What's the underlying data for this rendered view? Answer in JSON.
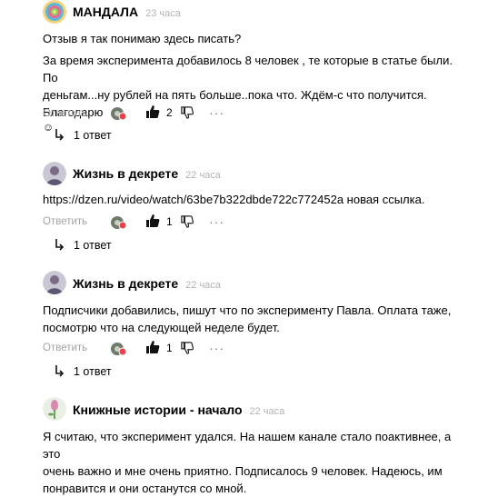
{
  "comments": [
    {
      "author": "МАНДАЛА",
      "time": "23 часа",
      "avatar": "mandala-avatar",
      "lines": [
        "Отзыв я так понимаю здесь писать?",
        "За время эксперимента добавилось 8 человек , те которые в статье были. По",
        "деньгам...ну рублей на пять больше..пока что. Ждём-с что получится. Благодарю"
      ],
      "reply_label": "Ответить",
      "likes": "2",
      "replies_label": "1 ответ"
    },
    {
      "author": "Жизнь в декрете",
      "time": "22 часа",
      "avatar": "person-avatar",
      "lines": [
        "https://dzen.ru/video/watch/63be7b322dbde722c772452a новая ссылка."
      ],
      "reply_label": "Ответить",
      "likes": "1",
      "replies_label": "1 ответ"
    },
    {
      "author": "Жизнь в декрете",
      "time": "22 часа",
      "avatar": "person-avatar",
      "lines": [
        "Подписчики добавились, пишут что по эксперименту Павла. Оплата таже,",
        "посмотрю что на следующей неделе будет."
      ],
      "reply_label": "Ответить",
      "likes": "1",
      "replies_label": "1 ответ"
    },
    {
      "author": "Книжные истории - начало",
      "time": "22 часа",
      "avatar": "flower-avatar",
      "lines": [
        "Я считаю, что эксперимент удался. На нашем канале стало поактивнее, а это",
        "очень важно и мне очень приятно. Подписалось 9 человек. Надеюсь, им",
        "понравится и они останутся со мной."
      ]
    }
  ]
}
